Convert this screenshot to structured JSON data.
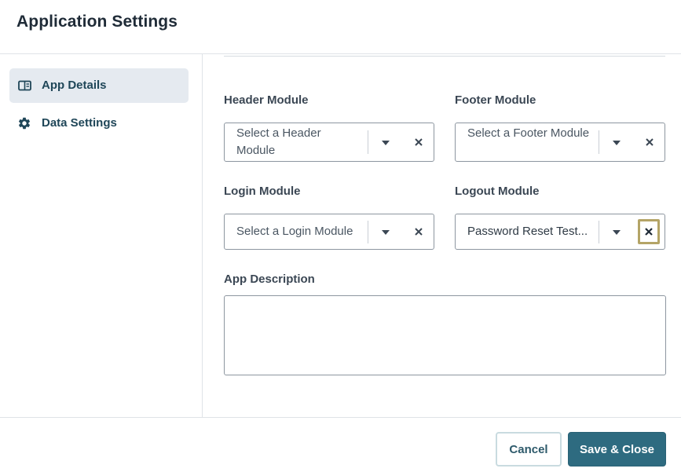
{
  "dialog": {
    "title": "Application Settings"
  },
  "sidebar": {
    "items": [
      {
        "label": "App Details",
        "icon": "panel-icon",
        "active": true
      },
      {
        "label": "Data Settings",
        "icon": "gear-icon",
        "active": false
      }
    ]
  },
  "form": {
    "header_module": {
      "label": "Header Module",
      "placeholder": "Select a Header Module"
    },
    "footer_module": {
      "label": "Footer Module",
      "placeholder": "Select a Footer Module"
    },
    "login_module": {
      "label": "Login Module",
      "placeholder": "Select a Login Module"
    },
    "logout_module": {
      "label": "Logout Module",
      "value": "Password Reset Test..."
    },
    "app_description": {
      "label": "App Description",
      "value": ""
    }
  },
  "footer": {
    "cancel_label": "Cancel",
    "save_label": "Save & Close"
  },
  "colors": {
    "accent": "#2e6b80",
    "active_nav_bg": "#e5eaf0",
    "focus_ring": "#b4a466"
  }
}
